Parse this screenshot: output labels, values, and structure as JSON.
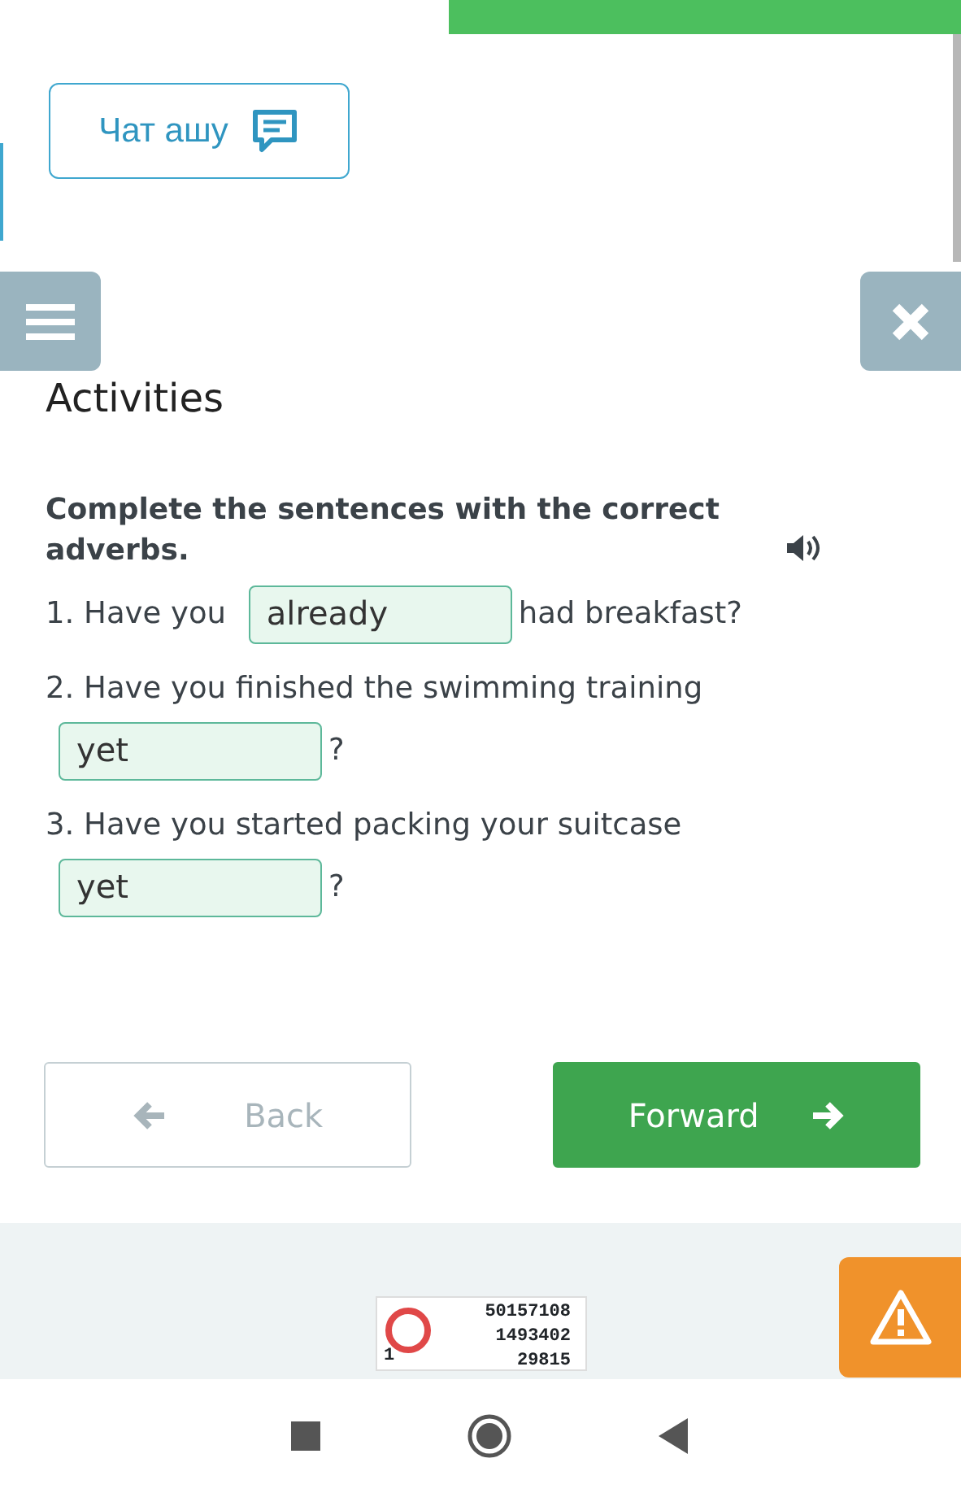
{
  "chat_button": {
    "label": "Чат ашу"
  },
  "heading": "Activities",
  "instruction": "Complete the sentences with the correct adverbs.",
  "sentences": [
    {
      "before": "1. Have you",
      "answer": "already",
      "after": "had breakfast?"
    },
    {
      "before": "2. Have you finished the swimming training",
      "answer": "yet",
      "after": "?"
    },
    {
      "before": "3. Have you started packing your suitcase",
      "answer": "yet",
      "after": "?"
    }
  ],
  "nav": {
    "back": {
      "label": "Back",
      "disabled": true
    },
    "forward": {
      "label": "Forward",
      "disabled": false
    }
  },
  "counter": {
    "corner": "1",
    "lines": [
      "50157108",
      "1493402",
      "29815"
    ]
  }
}
